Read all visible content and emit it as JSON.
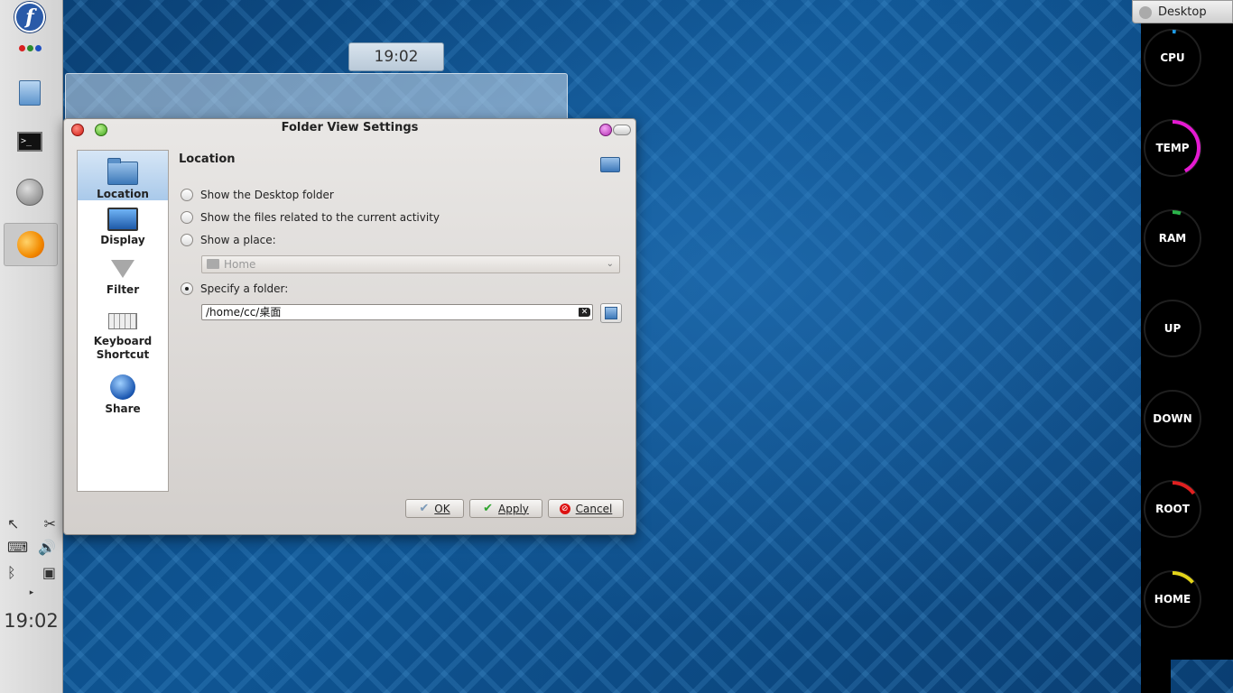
{
  "panel": {
    "clock": "19:02",
    "launchers": [
      "fedora-menu",
      "activity-dots",
      "file-manager",
      "terminal",
      "browser",
      "kde-settings"
    ]
  },
  "desktop": {
    "clock_widget": "19:02",
    "activity_button": "Desktop"
  },
  "dialog": {
    "title": "Folder View Settings",
    "pages": [
      {
        "label": "Location",
        "icon": "folder-icon"
      },
      {
        "label": "Display",
        "icon": "monitor-icon"
      },
      {
        "label": "Filter",
        "icon": "funnel-icon"
      },
      {
        "label": "Keyboard Shortcut",
        "icon": "keyboard-icon"
      },
      {
        "label": "Share",
        "icon": "globe-icon"
      }
    ],
    "selected_page": "Location",
    "section_title": "Location",
    "options": {
      "desktop_folder": "Show the Desktop folder",
      "activity_files": "Show the files related to the current activity",
      "place": "Show a place:",
      "folder": "Specify a folder:"
    },
    "place_value": "Home",
    "folder_value": "/home/cc/桌面",
    "buttons": {
      "ok": "OK",
      "apply": "Apply",
      "cancel": "Cancel"
    }
  },
  "sysmon": {
    "gauges": [
      {
        "label": "CPU",
        "level": 0.02,
        "color": "#1e9be6"
      },
      {
        "label": "TEMP",
        "level": 0.42,
        "color": "#e51ad2"
      },
      {
        "label": "RAM",
        "level": 0.05,
        "color": "#2bb34a"
      },
      {
        "label": "UP",
        "level": 0.0,
        "color": "#1e9be6"
      },
      {
        "label": "DOWN",
        "level": 0.0,
        "color": "#1e9be6"
      },
      {
        "label": "ROOT",
        "level": 0.15,
        "color": "#e02020"
      },
      {
        "label": "HOME",
        "level": 0.14,
        "color": "#e3d41a"
      }
    ]
  }
}
